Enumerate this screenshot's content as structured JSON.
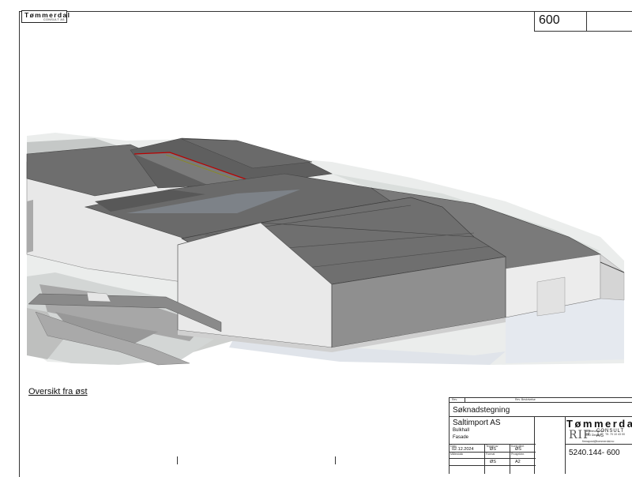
{
  "drawing": {
    "sheet_number": "600",
    "view_caption": "Oversikt fra øst"
  },
  "header_logo": {
    "name": "Tømmerdal",
    "sub": "CONSULT AS"
  },
  "title_block": {
    "header_rev": "Rev.",
    "header_rev_desc": "Rev. Beskrivelse",
    "doc_type": "Søknadstegning",
    "client": "Saltimport AS",
    "building": "Bulkhall",
    "view": "Fasade",
    "label_date": "Dato",
    "label_drawn": "Tegnet av",
    "label_checked": "Kontrollert",
    "label_scale": "Målestokk",
    "label_format": "Format",
    "label_project": "Prosjektnr.",
    "date": "02.12.2024",
    "drawn_by": "ØS",
    "checked_by": "ØS",
    "drawn_by_2": "ØS",
    "format": "A2",
    "doc_id": "5240.144- 600",
    "company": {
      "name": "Tømmerdal",
      "sub": "CONSULT AS",
      "rif": "RIF",
      "address_1": "Notenesvegen 5",
      "address_2": "6002 Ålesund",
      "phone": "Tlf. 70 10 43 00",
      "email": "firmapost@tommerdal.no"
    }
  }
}
